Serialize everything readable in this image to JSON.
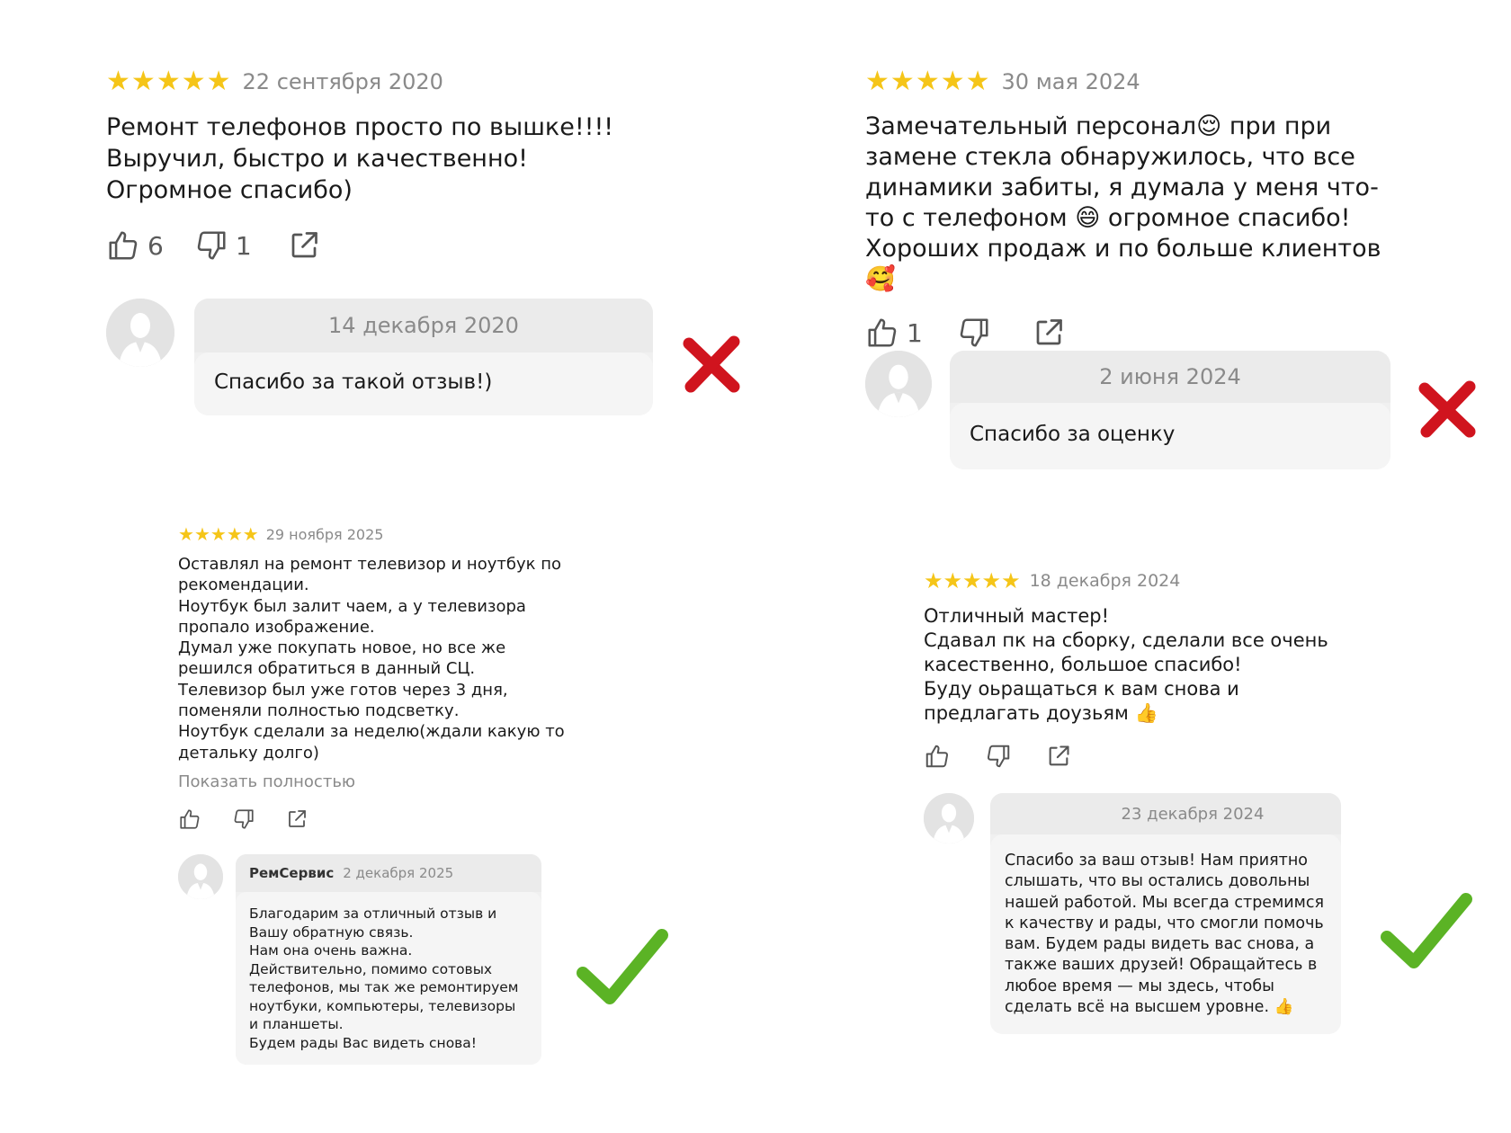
{
  "colors": {
    "star": "#f5c518",
    "cross": "#d0141e",
    "check": "#5bb325",
    "muted": "#8a8a8a"
  },
  "reviews": [
    {
      "rating": 5,
      "date": "22 сентября 2020",
      "text": "Ремонт телефонов просто по вышке!!!!\nВыручил, быстро и качественно! Огромное спасибо)",
      "likes": "6",
      "dislikes": "1",
      "response": {
        "author": "",
        "date": "14 декабря 2020",
        "text": "Спасибо за такой отзыв!)"
      },
      "verdict": "cross-icon"
    },
    {
      "rating": 5,
      "date": "30 мая 2024",
      "text": "Замечательный персонал😌 при при замене стекла обнаружилось, что все динамики забиты, я думала у меня что-то с телефоном 😄 огромное спасибо! Хороших продаж и по больше клиентов 🥰",
      "likes": "1",
      "dislikes": "",
      "response": {
        "author": "",
        "date": "2 июня 2024",
        "text": "Спасибо за оценку"
      },
      "verdict": "cross-icon"
    },
    {
      "rating": 5,
      "date": "29 ноября 2025",
      "text": "Оставлял на ремонт телевизор и ноутбук по рекомендации.\nНоутбук был залит чаем, а у телевизора пропало изображение.\nДумал уже покупать новое, но все же решился обратиться в данный СЦ.\nТелевизор был уже готов через 3 дня, поменяли полностью подсветку.\nНоутбук сделали за неделю(ждали какую то детальку долго)",
      "show_more": "Показать полностью",
      "likes": "",
      "dislikes": "",
      "response": {
        "author": "РемСервис",
        "date": "2 декабря 2025",
        "text": "Благодарим за отличный отзыв и Вашу обратную связь.\nНам она очень важна.\nДействительно, помимо сотовых телефонов, мы так же ремонтируем ноутбуки, компьютеры, телевизоры и планшеты.\nБудем рады Вас видеть снова!"
      },
      "verdict": "check-icon"
    },
    {
      "rating": 5,
      "date": "18 декабря 2024",
      "text": "Отличный мастер!\nСдавал пк на сборку, сделали все очень касественно, большое спасибо!\nБуду оьращаться к вам снова и предлагать доузьям 👍",
      "likes": "",
      "dislikes": "",
      "response": {
        "author": "",
        "date": "23 декабря 2024",
        "text": "Спасибо за ваш отзыв! Нам приятно слышать, что вы остались довольны нашей работой. Мы всегда стремимся к качеству и рады, что смогли помочь вам. Будем рады видеть вас снова, а также ваших друзей! Обращайтесь в любое время — мы здесь, чтобы сделать всё на высшем уровне. 👍"
      },
      "verdict": "check-icon"
    }
  ]
}
